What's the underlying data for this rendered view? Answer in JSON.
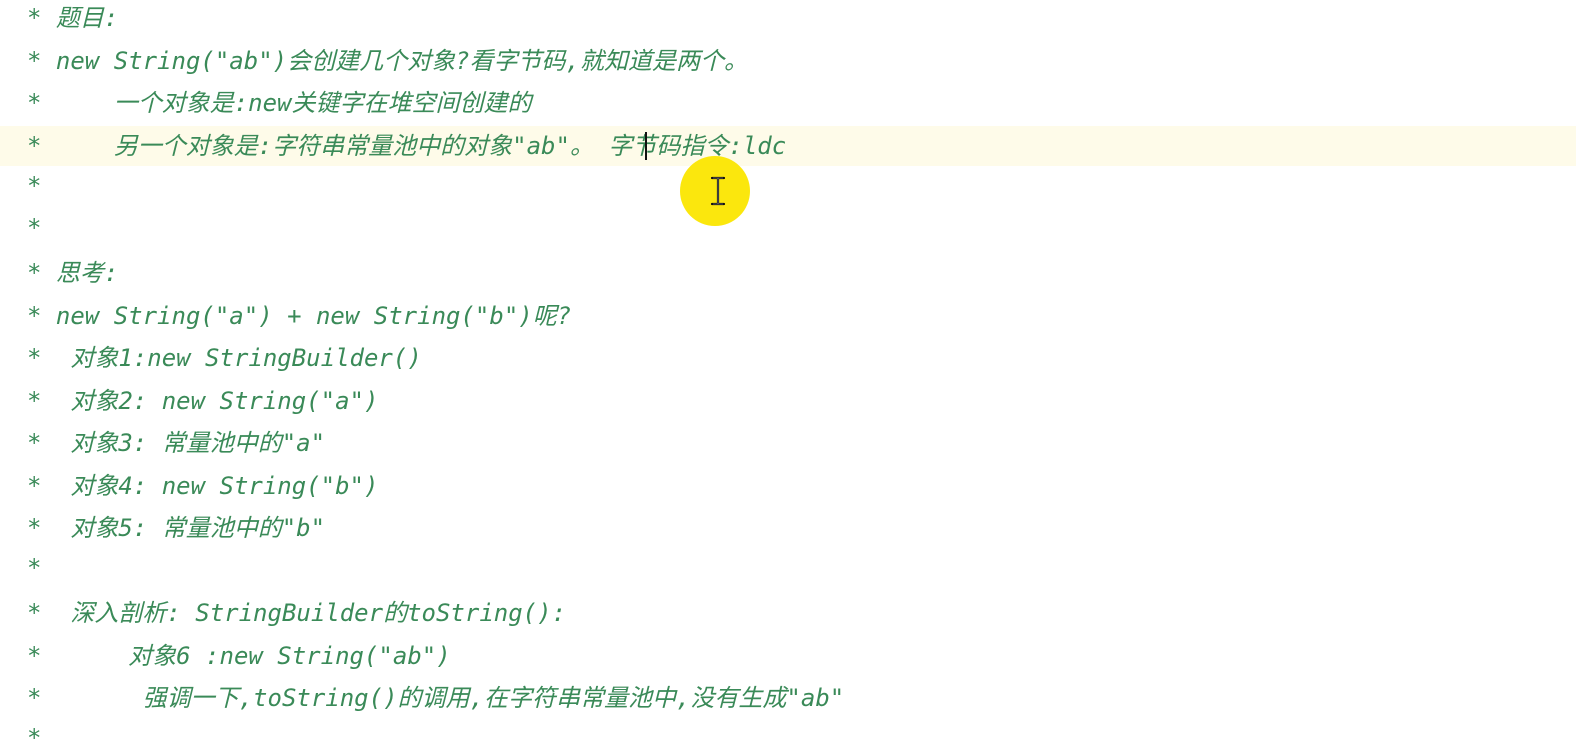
{
  "editor": {
    "current_line_index": 3,
    "lines": [
      {
        "text": "* 题目:"
      },
      {
        "text": "* new String(\"ab\")会创建几个对象?看字节码,就知道是两个。"
      },
      {
        "text": "*     一个对象是:new关键字在堆空间创建的"
      },
      {
        "text": "*     另一个对象是:字符串常量池中的对象\"ab\"。 字节码指令:ldc"
      },
      {
        "text": "*"
      },
      {
        "text": "*"
      },
      {
        "text": "* 思考:"
      },
      {
        "text": "* new String(\"a\") + new String(\"b\")呢?"
      },
      {
        "text": "*  对象1:new StringBuilder()"
      },
      {
        "text": "*  对象2: new String(\"a\")"
      },
      {
        "text": "*  对象3: 常量池中的\"a\""
      },
      {
        "text": "*  对象4: new String(\"b\")"
      },
      {
        "text": "*  对象5: 常量池中的\"b\""
      },
      {
        "text": "*"
      },
      {
        "text": "*  深入剖析: StringBuilder的toString():"
      },
      {
        "text": "*      对象6 :new String(\"ab\")"
      },
      {
        "text": "*       强调一下,toString()的调用,在字符串常量池中,没有生成\"ab\""
      },
      {
        "text": "*"
      }
    ]
  },
  "colors": {
    "comment_text": "#3a8a58",
    "current_line_bg": "#fefbe9",
    "cursor_highlight": "#fbe600"
  },
  "icons": {
    "text_cursor": "i-beam-cursor-icon"
  }
}
